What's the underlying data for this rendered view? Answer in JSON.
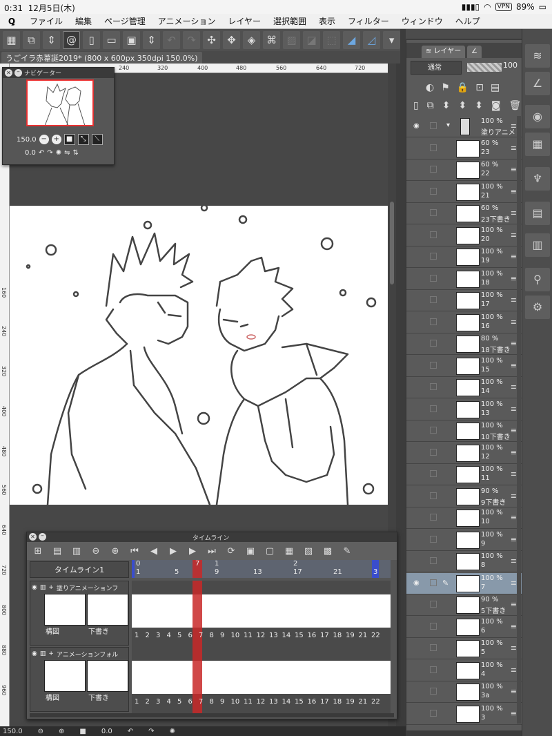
{
  "status": {
    "time": "0:31",
    "date": "12月5日(木)",
    "vpn": "VPN",
    "battery": "89%"
  },
  "menu": [
    "ファイル",
    "編集",
    "ページ管理",
    "アニメーション",
    "レイヤー",
    "選択範囲",
    "表示",
    "フィルター",
    "ウィンドウ",
    "ヘルプ"
  ],
  "doc_tab": "うごイラ赤葦誕2019* (800 x 600px 350dpi 150.0%)",
  "ruler_h": [
    "240",
    "320",
    "400",
    "480",
    "560",
    "640",
    "720"
  ],
  "ruler_v": [
    "160",
    "240",
    "320",
    "400",
    "480",
    "560",
    "640",
    "720",
    "800",
    "880",
    "960"
  ],
  "navigator": {
    "title": "ナビゲーター",
    "zoom": "150.0",
    "rotation": "0.0"
  },
  "timeline": {
    "title": "タイムライン",
    "name": "タイムライン1",
    "ruler_marks": [
      "0",
      "1",
      "5",
      "7",
      "1",
      "9",
      "13",
      "2",
      "17",
      "21",
      "3"
    ],
    "current_frame": "7",
    "tracks": [
      {
        "name": "塗りアニメーションフ",
        "thumb_labels": [
          "構図",
          "下書き"
        ]
      },
      {
        "name": "アニメーションフォル",
        "thumb_labels": [
          "構図",
          "下書き"
        ]
      }
    ],
    "frame_numbers": [
      "1",
      "2",
      "3",
      "4",
      "5",
      "6",
      "7",
      "8",
      "9",
      "10",
      "11",
      "12",
      "13",
      "14",
      "15",
      "16",
      "17",
      "18",
      "19",
      "21",
      "22"
    ]
  },
  "layer_panel": {
    "tab_label": "レイヤー",
    "blend_mode": "通常",
    "opacity": "100",
    "layers": [
      {
        "percent": "100 %",
        "name": "塗りアニメ",
        "folder": true,
        "visible": true
      },
      {
        "percent": "60 %",
        "name": "23",
        "visible": false
      },
      {
        "percent": "60 %",
        "name": "22",
        "visible": false
      },
      {
        "percent": "100 %",
        "name": "21",
        "visible": false
      },
      {
        "percent": "60 %",
        "name": "23下書き",
        "visible": false
      },
      {
        "percent": "100 %",
        "name": "20",
        "visible": false
      },
      {
        "percent": "100 %",
        "name": "19",
        "visible": false
      },
      {
        "percent": "100 %",
        "name": "18",
        "visible": false
      },
      {
        "percent": "100 %",
        "name": "17",
        "visible": false
      },
      {
        "percent": "100 %",
        "name": "16",
        "visible": false
      },
      {
        "percent": "80 %",
        "name": "18下書き",
        "visible": false
      },
      {
        "percent": "100 %",
        "name": "15",
        "visible": false
      },
      {
        "percent": "100 %",
        "name": "14",
        "visible": false
      },
      {
        "percent": "100 %",
        "name": "13",
        "visible": false
      },
      {
        "percent": "100 %",
        "name": "10下書き",
        "visible": false
      },
      {
        "percent": "100 %",
        "name": "12",
        "visible": false
      },
      {
        "percent": "100 %",
        "name": "11",
        "visible": false
      },
      {
        "percent": "90 %",
        "name": "9下書き",
        "visible": false
      },
      {
        "percent": "100 %",
        "name": "10",
        "visible": false
      },
      {
        "percent": "100 %",
        "name": "9",
        "visible": false
      },
      {
        "percent": "100 %",
        "name": "8",
        "visible": false
      },
      {
        "percent": "100 %",
        "name": "7",
        "visible": true,
        "selected": true
      },
      {
        "percent": "90 %",
        "name": "5下書き",
        "visible": false
      },
      {
        "percent": "100 %",
        "name": "6",
        "visible": false
      },
      {
        "percent": "100 %",
        "name": "5",
        "visible": false
      },
      {
        "percent": "100 %",
        "name": "4",
        "visible": false
      },
      {
        "percent": "100 %",
        "name": "3a",
        "visible": false
      },
      {
        "percent": "100 %",
        "name": "3",
        "visible": false
      }
    ]
  },
  "bottom": {
    "zoom": "150.0",
    "rotation": "0.0"
  }
}
